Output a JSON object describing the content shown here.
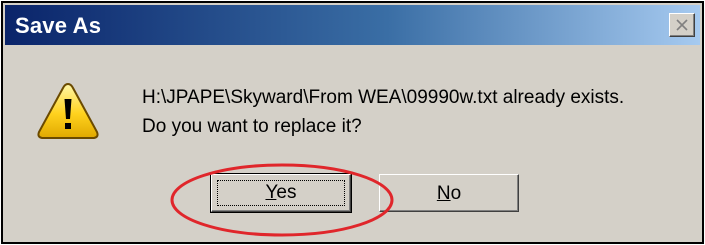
{
  "window": {
    "title": "Save As",
    "close_symbol": "×"
  },
  "message": {
    "line1": "H:\\JPAPE\\Skyward\\From WEA\\09990w.txt already exists.",
    "line2": "Do you want to replace it?"
  },
  "buttons": {
    "yes": {
      "mnemonic": "Y",
      "rest": "es"
    },
    "no": {
      "mnemonic": "N",
      "rest": "o"
    }
  },
  "icons": {
    "warning": "warning-triangle-icon",
    "close": "close-icon"
  },
  "colors": {
    "titlebar_start": "#0a246a",
    "titlebar_end": "#a6caf0",
    "dialog_face": "#d4d0c8",
    "annotation": "#e0262b",
    "warning_fill": "#ffd21e"
  }
}
